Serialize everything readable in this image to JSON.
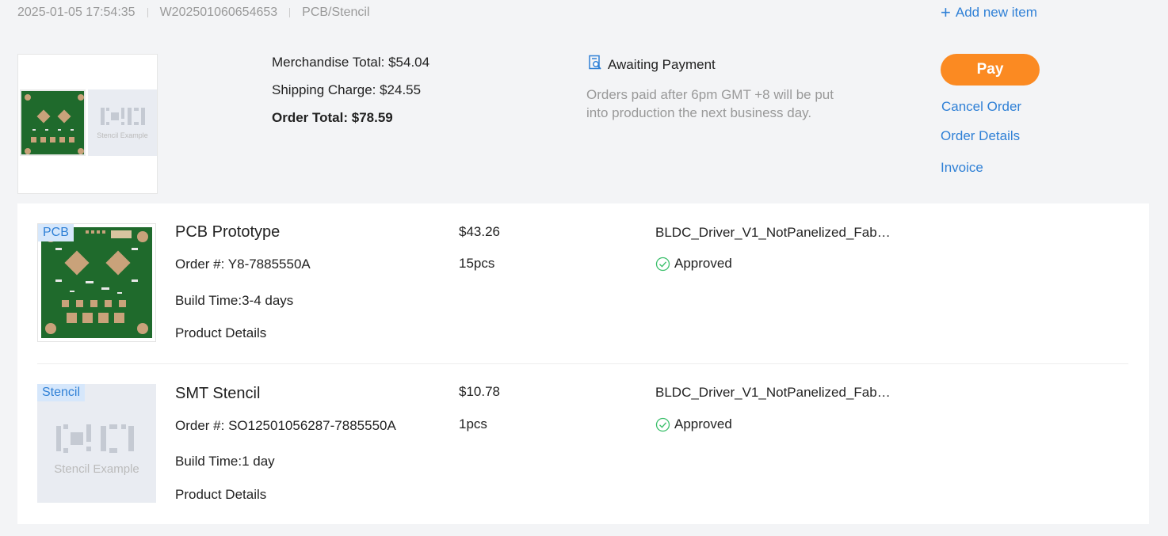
{
  "order": {
    "datetime": "2025-01-05 17:54:35",
    "order_id": "W202501060654653",
    "category": "PCB/Stencil",
    "add_new_item": "Add new item"
  },
  "summary": {
    "thumb_stencil_caption": "Stencil Example",
    "merchandise_total": "Merchandise Total: $54.04",
    "shipping_charge": "Shipping Charge: $24.55",
    "order_total": "Order Total: $78.59",
    "status": "Awaiting Payment",
    "status_note": "Orders paid after 6pm GMT +8 will be put into production the next business day."
  },
  "actions": {
    "pay": "Pay",
    "cancel": "Cancel Order",
    "details": "Order Details",
    "invoice": "Invoice"
  },
  "items": [
    {
      "tag": "PCB",
      "name": "PCB Prototype",
      "order_no": "Order #: Y8-7885550A",
      "build_time": "Build Time:3-4 days",
      "details_link": "Product Details",
      "price": "$43.26",
      "qty": "15pcs",
      "file": "BLDC_Driver_V1_NotPanelized_Fab…",
      "status": "Approved"
    },
    {
      "tag": "Stencil",
      "image_caption": "Stencil Example",
      "name": "SMT Stencil",
      "order_no": "Order #: SO12501056287-7885550A",
      "build_time": "Build Time:1 day",
      "details_link": "Product Details",
      "price": "$10.78",
      "qty": "1pcs",
      "file": "BLDC_Driver_V1_NotPanelized_Fab…",
      "status": "Approved"
    }
  ],
  "colors": {
    "accent": "#2f80d6",
    "pay": "#fb8a22",
    "approved": "#3bbf6b",
    "pcb_green": "#1f6a2c"
  }
}
